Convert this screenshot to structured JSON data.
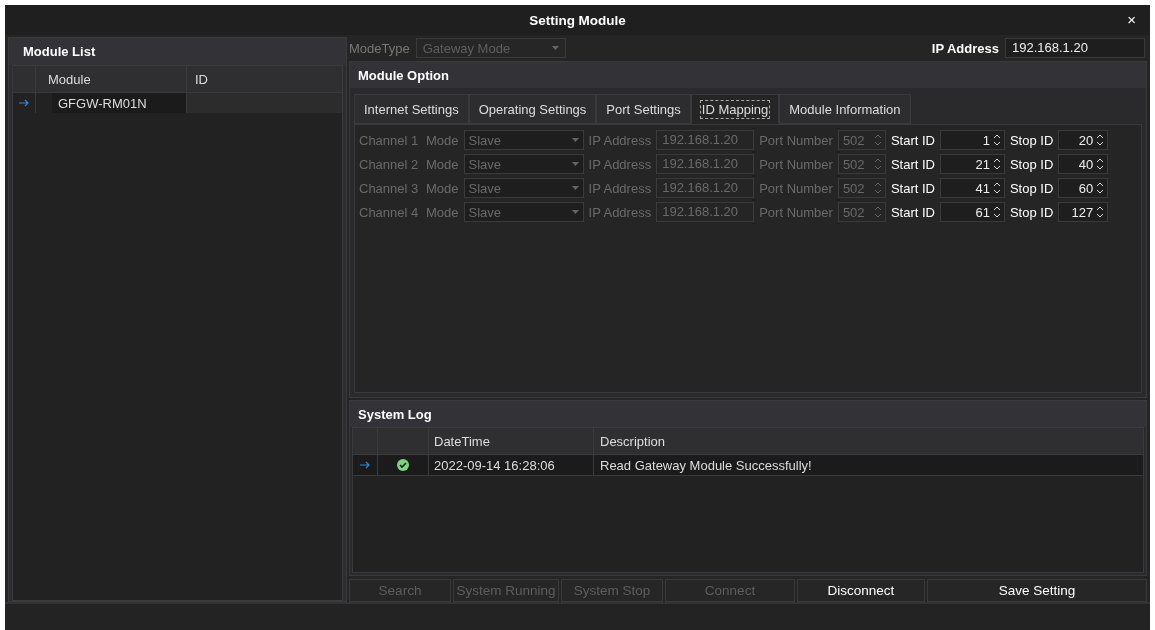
{
  "window": {
    "title": "Setting Module",
    "close": "×"
  },
  "module_list": {
    "title": "Module List",
    "columns": [
      "Module",
      "ID"
    ],
    "rows": [
      {
        "module": "GFGW-RM01N",
        "selected": true
      }
    ]
  },
  "mode_type": {
    "label": "ModeType",
    "value": "Gateway Mode",
    "disabled": true
  },
  "ip_address": {
    "label": "IP Address",
    "value": "192.168.1.20"
  },
  "module_option": {
    "title": "Module Option",
    "tabs": [
      {
        "label": "Internet Settings",
        "selected": false
      },
      {
        "label": "Operating Settings",
        "selected": false
      },
      {
        "label": "Port Settings",
        "selected": false
      },
      {
        "label": "ID Mapping",
        "selected": true
      },
      {
        "label": "Module Information",
        "selected": false
      }
    ],
    "channels": [
      {
        "label": "Channel 1",
        "mode_label": "Mode",
        "mode": "Slave",
        "ip_label": "IP Address",
        "ip": "192.168.1.20",
        "port_label": "Port Number",
        "port": "502",
        "start_label": "Start ID",
        "start": "1",
        "stop_label": "Stop ID",
        "stop": "20",
        "disabled": true
      },
      {
        "label": "Channel 2",
        "mode_label": "Mode",
        "mode": "Slave",
        "ip_label": "IP Address",
        "ip": "192.168.1.20",
        "port_label": "Port Number",
        "port": "502",
        "start_label": "Start ID",
        "start": "21",
        "stop_label": "Stop ID",
        "stop": "40",
        "disabled": true
      },
      {
        "label": "Channel 3",
        "mode_label": "Mode",
        "mode": "Slave",
        "ip_label": "IP Address",
        "ip": "192.168.1.20",
        "port_label": "Port Number",
        "port": "502",
        "start_label": "Start ID",
        "start": "41",
        "stop_label": "Stop ID",
        "stop": "60",
        "disabled": true
      },
      {
        "label": "Channel 4",
        "mode_label": "Mode",
        "mode": "Slave",
        "ip_label": "IP Address",
        "ip": "192.168.1.20",
        "port_label": "Port Number",
        "port": "502",
        "start_label": "Start ID",
        "start": "61",
        "stop_label": "Stop ID",
        "stop": "127",
        "disabled": true
      }
    ]
  },
  "system_log": {
    "title": "System Log",
    "columns": [
      "DateTime",
      "Description"
    ],
    "rows": [
      {
        "kind": "success",
        "datetime": "2022-09-14 16:28:06",
        "description": "Read Gateway Module Successfully!",
        "selected": true
      }
    ]
  },
  "buttons": [
    {
      "label": "Search",
      "disabled": true
    },
    {
      "label": "System Running",
      "disabled": true
    },
    {
      "label": "System Stop",
      "disabled": true
    },
    {
      "label": "Connect",
      "disabled": true
    },
    {
      "label": "Disconnect",
      "disabled": false
    },
    {
      "label": "Save Setting",
      "disabled": false
    }
  ]
}
